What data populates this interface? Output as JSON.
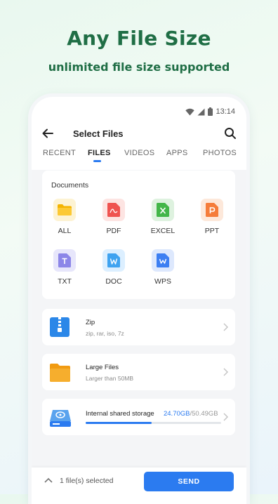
{
  "promo": {
    "headline": "Any File Size",
    "subline": "unlimited file size supported"
  },
  "status_bar": {
    "time": "13:14",
    "icons": [
      "wifi-icon",
      "signal-icon",
      "battery-icon"
    ]
  },
  "app_bar": {
    "title": "Select Files",
    "back_icon": "arrow-left-icon",
    "search_icon": "search-icon"
  },
  "tabs": [
    {
      "label": "RECENT",
      "active": false
    },
    {
      "label": "FILES",
      "active": true
    },
    {
      "label": "VIDEOS",
      "active": false
    },
    {
      "label": "APPS",
      "active": false
    },
    {
      "label": "PHOTOS",
      "active": false
    }
  ],
  "documents": {
    "title": "Documents",
    "items": [
      {
        "label": "ALL",
        "icon": "folder-icon",
        "color": "#f4b400"
      },
      {
        "label": "PDF",
        "icon": "pdf-icon",
        "color": "#ef5350"
      },
      {
        "label": "EXCEL",
        "icon": "excel-icon",
        "color": "#43b649"
      },
      {
        "label": "PPT",
        "icon": "ppt-icon",
        "color": "#f57c3a"
      },
      {
        "label": "TXT",
        "icon": "txt-icon",
        "color": "#8c86e8"
      },
      {
        "label": "DOC",
        "icon": "doc-icon",
        "color": "#3fa3f0"
      },
      {
        "label": "WPS",
        "icon": "wps-icon",
        "color": "#3d7ff2"
      }
    ]
  },
  "rows": {
    "zip": {
      "name": "Zip",
      "desc": "zip, rar, iso, 7z",
      "icon": "zip-icon"
    },
    "large": {
      "name": "Large Files",
      "desc": "Larger than 50MB",
      "icon": "folder-icon"
    },
    "storage": {
      "name": "Internal shared storage",
      "used": "24.70GB",
      "total": "/50.49GB",
      "fraction": 0.489,
      "icon": "storage-icon"
    }
  },
  "bottom": {
    "selected_text": "1 file(s) selected",
    "send_label": "SEND"
  },
  "colors": {
    "accent": "#2b7bf0",
    "promo_green": "#1f6e45"
  }
}
